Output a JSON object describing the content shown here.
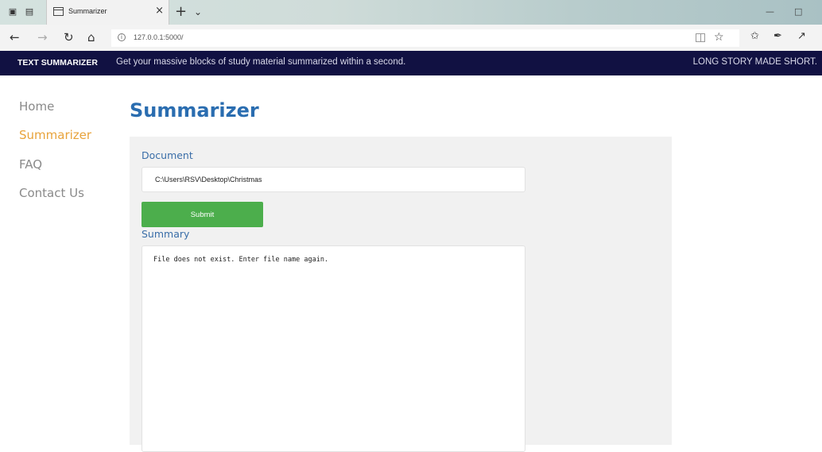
{
  "browser": {
    "tab_title": "Summarizer",
    "url": "127.0.0.1:5000/"
  },
  "site": {
    "brand": "TEXT SUMMARIZER",
    "tagline": "Get your massive blocks of study material summarized within a second.",
    "slogan": "LONG STORY MADE SHORT."
  },
  "sidebar": {
    "items": [
      {
        "label": "Home"
      },
      {
        "label": "Summarizer"
      },
      {
        "label": "FAQ"
      },
      {
        "label": "Contact Us"
      }
    ]
  },
  "main": {
    "title": "Summarizer",
    "document_label": "Document",
    "document_value": "C:\\Users\\RSV\\Desktop\\Christmas",
    "submit_label": "Submit",
    "summary_label": "Summary",
    "summary_value": "File does not exist. Enter file name again."
  },
  "colors": {
    "header_bg": "#111142",
    "accent_active": "#e8a33b",
    "title_blue": "#2a6db0",
    "submit_green": "#4cae4c"
  }
}
